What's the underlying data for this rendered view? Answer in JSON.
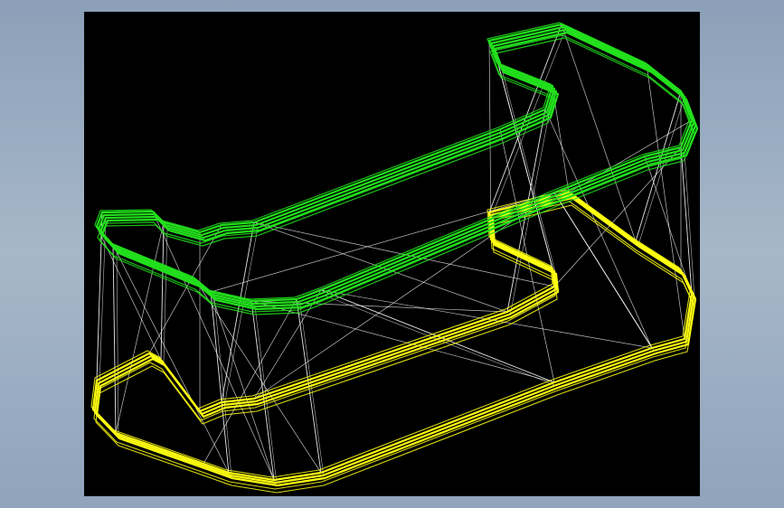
{
  "colors": {
    "background": "#9aabc0",
    "viewport": "#000000",
    "top_profile": "#22e01c",
    "bottom_profile": "#ffff10",
    "mesh": "#ffffff"
  },
  "model": {
    "render_mode": "wireframe",
    "profiles": [
      "top",
      "bottom"
    ]
  }
}
